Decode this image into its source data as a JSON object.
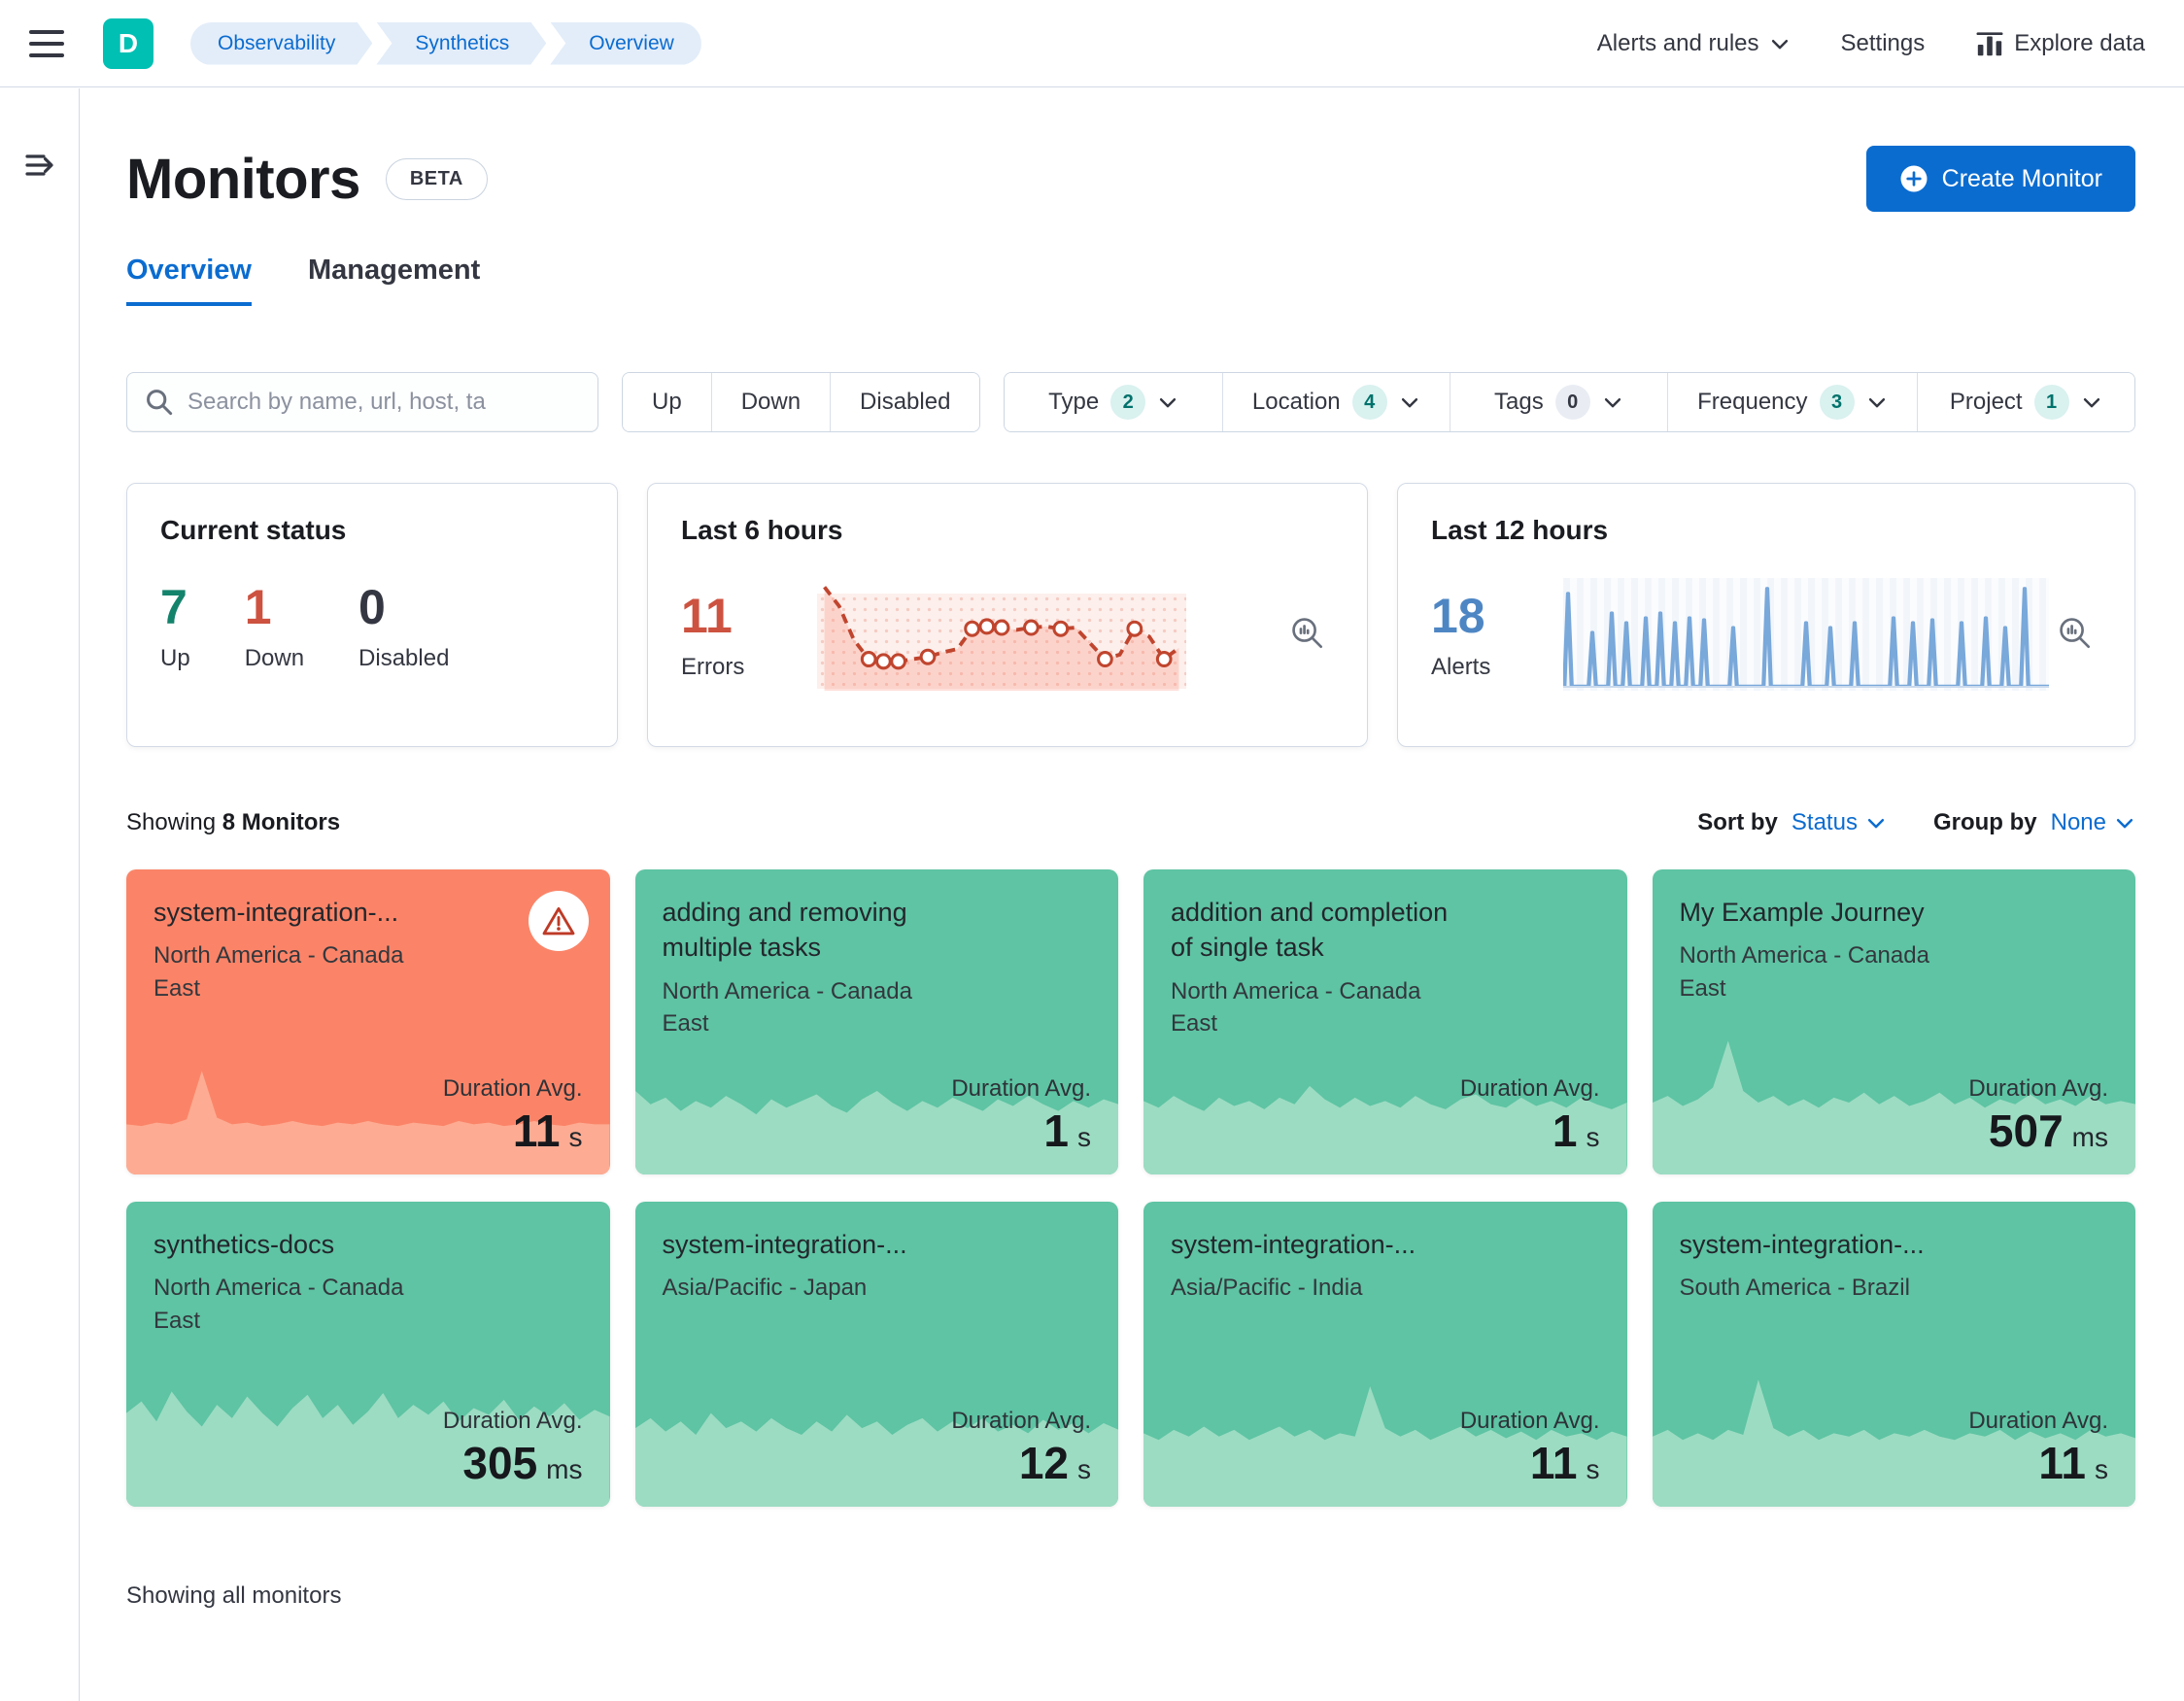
{
  "colors": {
    "primary": "#0b6cd0",
    "teal": "#00bfb3",
    "breadcrumb-bg": "#e3edf9",
    "success-text": "#14836b",
    "danger-text": "#cd5240",
    "danger-line": "#c0452e",
    "info-number": "#4e86c4",
    "info-line": "#79a8da",
    "card-green": "#5ec4a3",
    "card-green-spark": "#9cdcc3",
    "card-red": "#fb8468",
    "card-red-spark": "#fdac93",
    "badge-active-bg": "#d9f1ef",
    "badge-active-text": "#00726b",
    "badge-zero-bg": "#e9edf3"
  },
  "header": {
    "space_initial": "D",
    "breadcrumbs": [
      "Observability",
      "Synthetics",
      "Overview"
    ],
    "right": {
      "alerts_menu": "Alerts and rules",
      "settings": "Settings",
      "explore": "Explore data"
    }
  },
  "page": {
    "title": "Monitors",
    "beta_badge": "BETA",
    "create_button": "Create Monitor",
    "tabs": [
      {
        "label": "Overview",
        "active": true
      },
      {
        "label": "Management",
        "active": false
      }
    ],
    "showing_label": "Showing",
    "showing_strong": "8 Monitors",
    "sort_by_label": "Sort by",
    "sort_by_value": "Status",
    "group_by_label": "Group by",
    "group_by_value": "None",
    "footer_text": "Showing all monitors"
  },
  "filters": {
    "search_placeholder": "Search by name, url, host, ta",
    "status_buttons": [
      "Up",
      "Down",
      "Disabled"
    ],
    "dropdowns": [
      {
        "label": "Type",
        "count": "2"
      },
      {
        "label": "Location",
        "count": "4"
      },
      {
        "label": "Tags",
        "count": "0"
      },
      {
        "label": "Frequency",
        "count": "3"
      },
      {
        "label": "Project",
        "count": "1"
      }
    ]
  },
  "stats": {
    "current_status": {
      "title": "Current status",
      "items": [
        {
          "value": "7",
          "label": "Up",
          "color": "#14836b"
        },
        {
          "value": "1",
          "label": "Down",
          "color": "#cd5240"
        },
        {
          "value": "0",
          "label": "Disabled",
          "color": "#343741"
        }
      ]
    },
    "last6": {
      "title": "Last 6 hours",
      "value": "11",
      "label": "Errors",
      "chart": {
        "type": "line",
        "points": [
          [
            0.02,
            0.08
          ],
          [
            0.06,
            0.25
          ],
          [
            0.1,
            0.55
          ],
          [
            0.14,
            0.72
          ],
          [
            0.18,
            0.74
          ],
          [
            0.22,
            0.74
          ],
          [
            0.26,
            0.72
          ],
          [
            0.3,
            0.7
          ],
          [
            0.34,
            0.66
          ],
          [
            0.38,
            0.63
          ],
          [
            0.42,
            0.45
          ],
          [
            0.46,
            0.43
          ],
          [
            0.5,
            0.44
          ],
          [
            0.54,
            0.46
          ],
          [
            0.58,
            0.44
          ],
          [
            0.62,
            0.43
          ],
          [
            0.66,
            0.45
          ],
          [
            0.7,
            0.44
          ],
          [
            0.74,
            0.58
          ],
          [
            0.78,
            0.72
          ],
          [
            0.82,
            0.68
          ],
          [
            0.86,
            0.45
          ],
          [
            0.9,
            0.52
          ],
          [
            0.94,
            0.72
          ],
          [
            0.98,
            0.62
          ]
        ],
        "markers": [
          [
            0.14,
            0.72
          ],
          [
            0.18,
            0.74
          ],
          [
            0.22,
            0.74
          ],
          [
            0.3,
            0.7
          ],
          [
            0.42,
            0.45
          ],
          [
            0.46,
            0.43
          ],
          [
            0.5,
            0.44
          ],
          [
            0.58,
            0.44
          ],
          [
            0.66,
            0.45
          ],
          [
            0.78,
            0.72
          ],
          [
            0.86,
            0.45
          ],
          [
            0.94,
            0.72
          ]
        ]
      }
    },
    "last12": {
      "title": "Last 12 hours",
      "value": "18",
      "label": "Alerts",
      "chart": {
        "type": "spike",
        "spikes": [
          [
            0.01,
            0.95
          ],
          [
            0.06,
            0.55
          ],
          [
            0.1,
            0.75
          ],
          [
            0.13,
            0.65
          ],
          [
            0.17,
            0.7
          ],
          [
            0.2,
            0.75
          ],
          [
            0.23,
            0.65
          ],
          [
            0.26,
            0.7
          ],
          [
            0.29,
            0.68
          ],
          [
            0.35,
            0.6
          ],
          [
            0.42,
            1.0
          ],
          [
            0.5,
            0.65
          ],
          [
            0.55,
            0.6
          ],
          [
            0.6,
            0.65
          ],
          [
            0.68,
            0.7
          ],
          [
            0.72,
            0.65
          ],
          [
            0.76,
            0.68
          ],
          [
            0.82,
            0.65
          ],
          [
            0.87,
            0.7
          ],
          [
            0.91,
            0.6
          ],
          [
            0.95,
            1.0
          ]
        ]
      }
    }
  },
  "cards": {
    "duration_label": "Duration Avg."
  },
  "monitors": [
    {
      "name": "system-integration-...",
      "location": "North America - Canada East",
      "duration_value": "11",
      "duration_unit": "s",
      "status": "down",
      "spark": [
        0.3,
        0.29,
        0.31,
        0.3,
        0.33,
        0.62,
        0.34,
        0.3,
        0.31,
        0.29,
        0.3,
        0.32,
        0.3,
        0.29,
        0.31,
        0.3,
        0.32,
        0.3,
        0.29,
        0.31,
        0.3,
        0.29,
        0.32,
        0.3,
        0.31,
        0.29,
        0.3,
        0.32,
        0.3,
        0.29,
        0.31,
        0.3,
        0.3
      ]
    },
    {
      "name": "adding and removing multiple tasks",
      "location": "North America - Canada East",
      "duration_value": "1",
      "duration_unit": "s",
      "status": "up",
      "spark": [
        0.5,
        0.42,
        0.46,
        0.38,
        0.44,
        0.4,
        0.47,
        0.42,
        0.36,
        0.45,
        0.4,
        0.44,
        0.48,
        0.41,
        0.37,
        0.45,
        0.5,
        0.43,
        0.38,
        0.44,
        0.4,
        0.46,
        0.42,
        0.38,
        0.45,
        0.41,
        0.47,
        0.42,
        0.38,
        0.44,
        0.4,
        0.45,
        0.42
      ]
    },
    {
      "name": "addition and completion of single task",
      "location": "North America - Canada East",
      "duration_value": "1",
      "duration_unit": "s",
      "status": "up",
      "spark": [
        0.44,
        0.4,
        0.47,
        0.42,
        0.38,
        0.46,
        0.41,
        0.44,
        0.39,
        0.46,
        0.42,
        0.53,
        0.45,
        0.4,
        0.46,
        0.41,
        0.44,
        0.4,
        0.47,
        0.42,
        0.39,
        0.45,
        0.48,
        0.42,
        0.4,
        0.46,
        0.41,
        0.44,
        0.4,
        0.46,
        0.42,
        0.39,
        0.43
      ]
    },
    {
      "name": "My Example Journey",
      "location": "North America - Canada East",
      "duration_value": "507",
      "duration_unit": "ms",
      "status": "up",
      "spark": [
        0.43,
        0.47,
        0.41,
        0.45,
        0.52,
        0.8,
        0.5,
        0.43,
        0.47,
        0.41,
        0.45,
        0.4,
        0.46,
        0.43,
        0.49,
        0.42,
        0.47,
        0.41,
        0.44,
        0.49,
        0.42,
        0.46,
        0.4,
        0.45,
        0.42,
        0.48,
        0.42,
        0.45,
        0.41,
        0.47,
        0.42,
        0.44,
        0.42
      ]
    },
    {
      "name": "synthetics-docs",
      "location": "North America - Canada East",
      "duration_value": "305",
      "duration_unit": "ms",
      "status": "up",
      "spark": [
        0.56,
        0.63,
        0.51,
        0.69,
        0.57,
        0.48,
        0.61,
        0.53,
        0.66,
        0.56,
        0.48,
        0.59,
        0.67,
        0.53,
        0.61,
        0.49,
        0.57,
        0.68,
        0.53,
        0.61,
        0.55,
        0.63,
        0.51,
        0.59,
        0.55,
        0.64,
        0.52,
        0.6,
        0.54,
        0.62,
        0.52,
        0.58,
        0.54
      ]
    },
    {
      "name": "system-integration-...",
      "location": "Asia/Pacific - Japan",
      "duration_value": "12",
      "duration_unit": "s",
      "status": "up",
      "spark": [
        0.47,
        0.53,
        0.45,
        0.51,
        0.43,
        0.56,
        0.47,
        0.51,
        0.45,
        0.53,
        0.47,
        0.43,
        0.51,
        0.45,
        0.55,
        0.47,
        0.51,
        0.43,
        0.49,
        0.53,
        0.45,
        0.51,
        0.47,
        0.53,
        0.45,
        0.49,
        0.44,
        0.52,
        0.46,
        0.5,
        0.44,
        0.5,
        0.46
      ]
    },
    {
      "name": "system-integration-...",
      "location": "Asia/Pacific - India",
      "duration_value": "11",
      "duration_unit": "s",
      "status": "up",
      "spark": [
        0.44,
        0.4,
        0.46,
        0.42,
        0.48,
        0.42,
        0.46,
        0.4,
        0.44,
        0.48,
        0.42,
        0.46,
        0.4,
        0.44,
        0.42,
        0.72,
        0.47,
        0.42,
        0.46,
        0.4,
        0.44,
        0.48,
        0.42,
        0.46,
        0.41,
        0.45,
        0.4,
        0.46,
        0.42,
        0.44,
        0.4,
        0.45,
        0.42
      ]
    },
    {
      "name": "system-integration-...",
      "location": "South America - Brazil",
      "duration_value": "11",
      "duration_unit": "s",
      "status": "up",
      "spark": [
        0.42,
        0.46,
        0.4,
        0.44,
        0.4,
        0.46,
        0.43,
        0.76,
        0.47,
        0.42,
        0.46,
        0.4,
        0.44,
        0.42,
        0.46,
        0.4,
        0.44,
        0.42,
        0.46,
        0.42,
        0.4,
        0.44,
        0.42,
        0.46,
        0.4,
        0.45,
        0.41,
        0.44,
        0.4,
        0.46,
        0.42,
        0.44,
        0.41
      ]
    }
  ]
}
